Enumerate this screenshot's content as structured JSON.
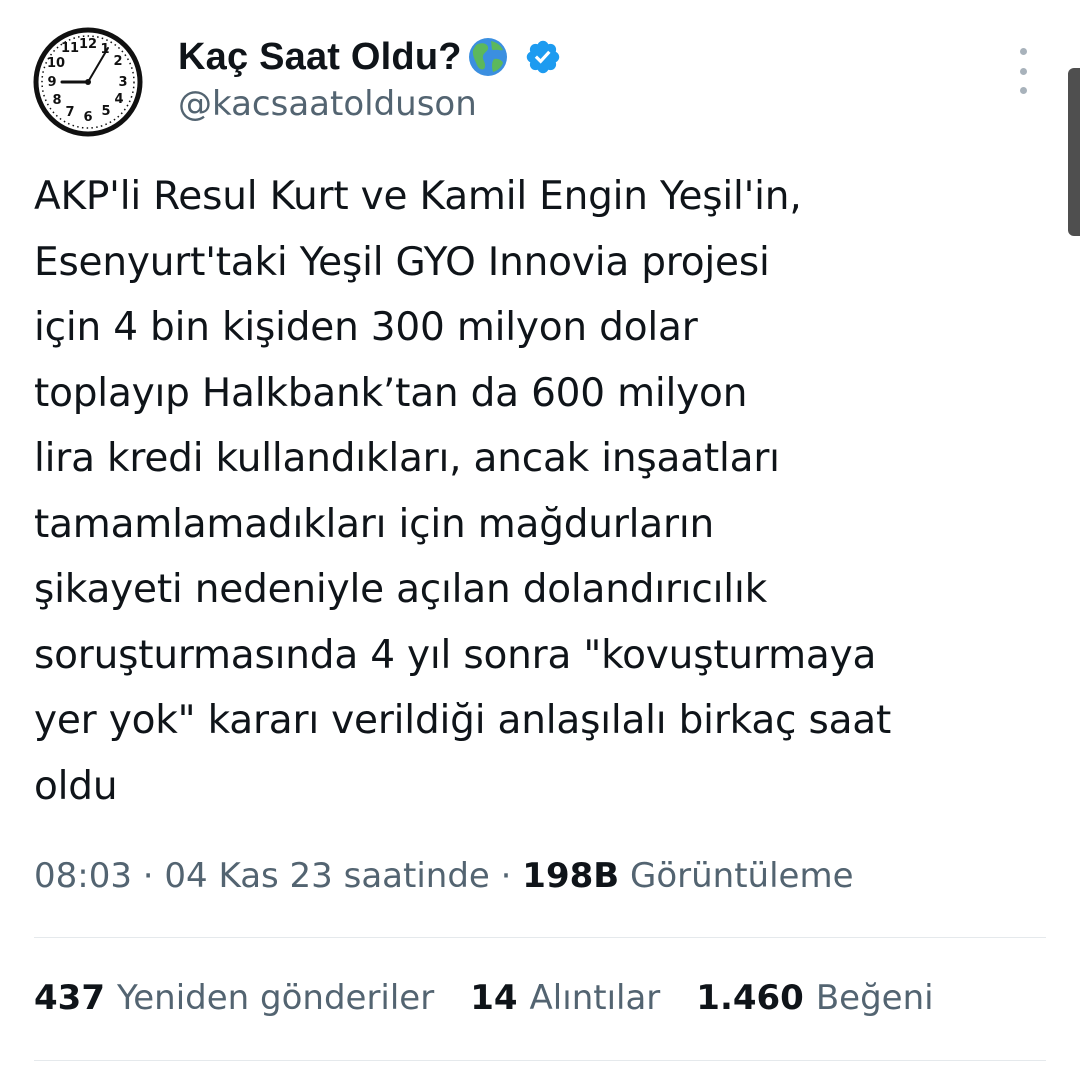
{
  "author": {
    "display_name": "Kaç Saat Oldu?",
    "handle": "@kacsaatolduson",
    "emoji_icon": "globe-americas-icon",
    "verified_icon": "verified-badge-icon",
    "verified_color": "#1d9bf0",
    "avatar_clock_numbers": [
      "11",
      "12",
      "1",
      "2",
      "3",
      "4",
      "5",
      "6",
      "7",
      "8",
      "9",
      "10"
    ]
  },
  "tweet": {
    "text": "AKP'li Resul Kurt ve Kamil Engin Yeşil'in,\nEsenyurt'taki Yeşil GYO Innovia projesi\niçin 4 bin kişiden 300 milyon dolar\ntoplayıp Halkbank’tan da 600 milyon\nlira kredi kullandıkları, ancak inşaatları\ntamamlamadıkları için mağdurların\nşikayeti nedeniyle açılan dolandırıcılık\nsoruşturmasında 4 yıl sonra \"kovuşturmaya\nyer yok\" kararı verildiği anlaşılalı birkaç saat\noldu"
  },
  "meta": {
    "time": "08:03",
    "separator": " · ",
    "date": "04 Kas 23 saatinde",
    "views_count": "198B",
    "views_label": "Görüntüleme"
  },
  "stats": {
    "retweets_count": "437",
    "retweets_label": "Yeniden gönderiler",
    "quotes_count": "14",
    "quotes_label": "Alıntılar",
    "likes_count": "1.460",
    "likes_label": "Beğeni"
  },
  "colors": {
    "text_primary": "#0f1419",
    "text_secondary": "#536471",
    "divider": "#e5e9ec"
  }
}
